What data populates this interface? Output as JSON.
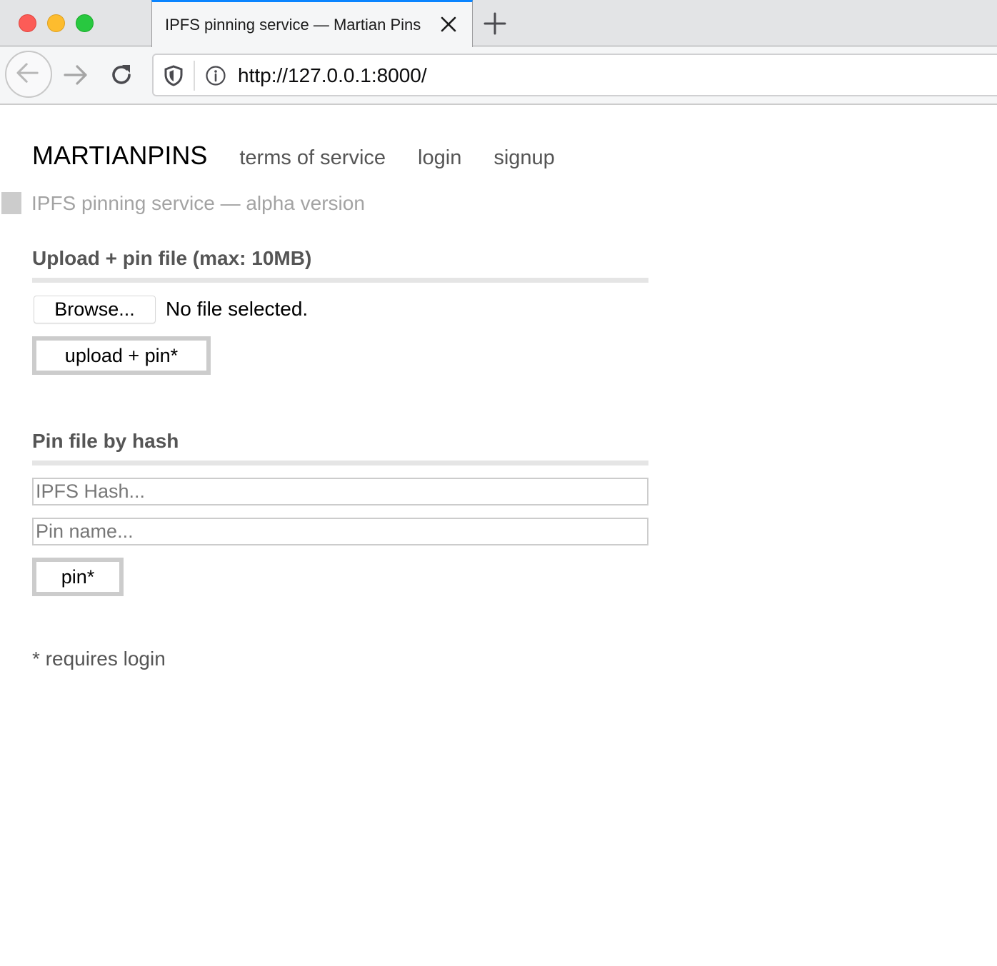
{
  "browser": {
    "tab": {
      "title": "IPFS pinning service — Martian Pins"
    },
    "url": "http://127.0.0.1:8000/",
    "icons": {
      "close_traffic": "red-circle",
      "minimize_traffic": "yellow-circle",
      "zoom_traffic": "green-circle",
      "tab_close": "x-icon",
      "new_tab": "plus-icon",
      "back": "arrow-left-icon",
      "forward": "arrow-right-icon",
      "reload": "reload-icon",
      "tracking_protection": "shield-icon",
      "site_info": "info-icon"
    },
    "colors": {
      "tab_accent": "#0a84ff",
      "traffic_red": "#fc5c57",
      "traffic_yellow": "#fdbc2e",
      "traffic_green": "#28c840"
    }
  },
  "site": {
    "brand": "MARTIANPINS",
    "nav": [
      {
        "label": "terms of service"
      },
      {
        "label": "login"
      },
      {
        "label": "signup"
      }
    ],
    "tagline": "IPFS pinning service — alpha version"
  },
  "upload_section": {
    "title": "Upload + pin file (max: 10MB)",
    "browse_label": "Browse...",
    "file_status": "No file selected.",
    "submit_label": "upload + pin*"
  },
  "hash_section": {
    "title": "Pin file by hash",
    "hash_input": {
      "value": "",
      "placeholder": "IPFS Hash..."
    },
    "name_input": {
      "value": "",
      "placeholder": "Pin name..."
    },
    "submit_label": "pin*"
  },
  "footnote": "* requires login"
}
